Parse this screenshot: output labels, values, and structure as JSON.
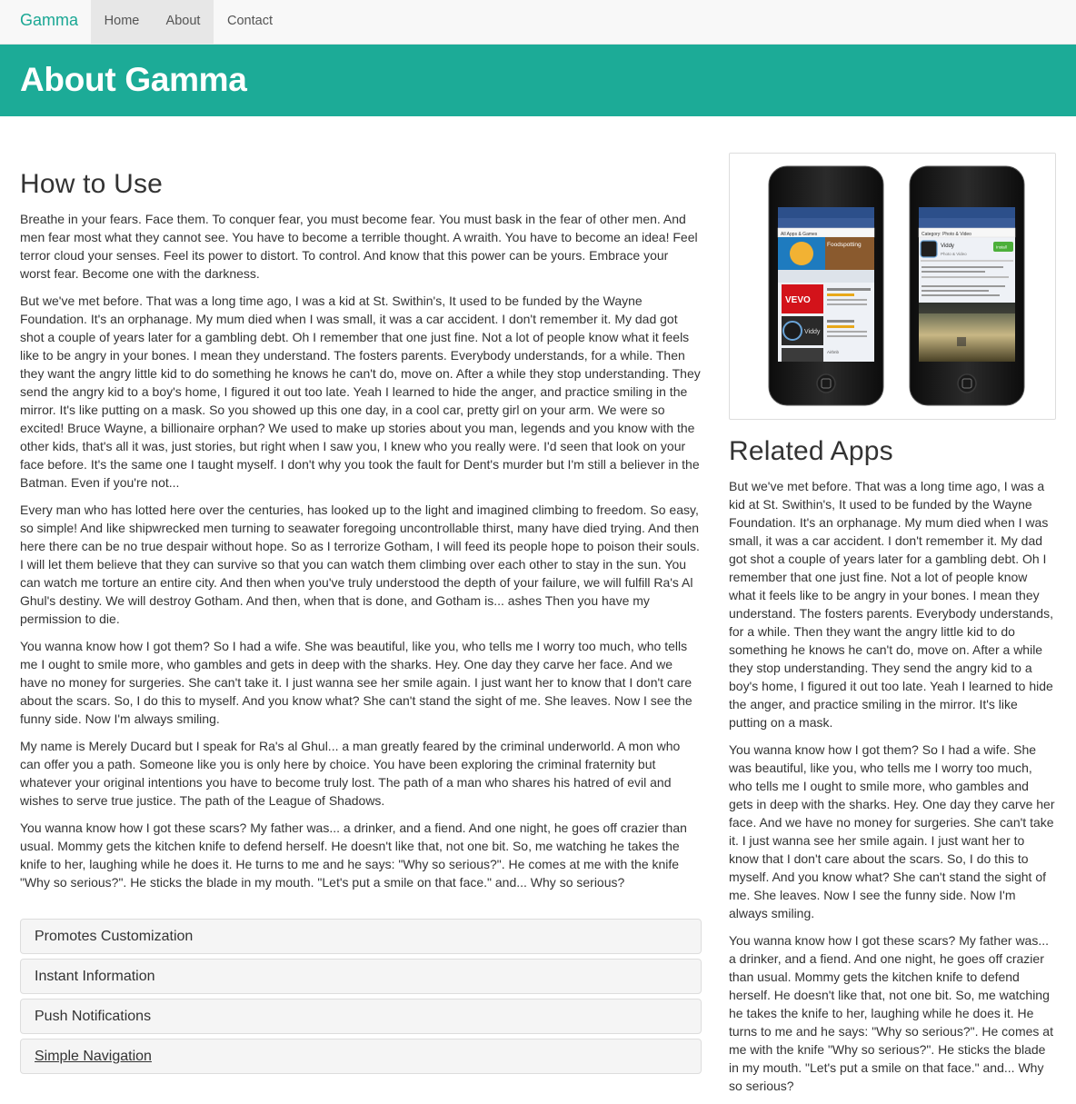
{
  "navbar": {
    "brand": "Gamma",
    "items": [
      {
        "label": "Home",
        "active": true
      },
      {
        "label": "About",
        "active": true
      },
      {
        "label": "Contact",
        "active": false
      }
    ]
  },
  "hero": {
    "title": "About Gamma"
  },
  "main": {
    "heading": "How to Use",
    "paragraphs": [
      "Breathe in your fears. Face them. To conquer fear, you must become fear. You must bask in the fear of other men. And men fear most what they cannot see. You have to become a terrible thought. A wraith. You have to become an idea! Feel terror cloud your senses. Feel its power to distort. To control. And know that this power can be yours. Embrace your worst fear. Become one with the darkness.",
      "But we've met before. That was a long time ago, I was a kid at St. Swithin's, It used to be funded by the Wayne Foundation. It's an orphanage. My mum died when I was small, it was a car accident. I don't remember it. My dad got shot a couple of years later for a gambling debt. Oh I remember that one just fine. Not a lot of people know what it feels like to be angry in your bones. I mean they understand. The fosters parents. Everybody understands, for a while. Then they want the angry little kid to do something he knows he can't do, move on. After a while they stop understanding. They send the angry kid to a boy's home, I figured it out too late. Yeah I learned to hide the anger, and practice smiling in the mirror. It's like putting on a mask. So you showed up this one day, in a cool car, pretty girl on your arm. We were so excited! Bruce Wayne, a billionaire orphan? We used to make up stories about you man, legends and you know with the other kids, that's all it was, just stories, but right when I saw you, I knew who you really were. I'd seen that look on your face before. It's the same one I taught myself. I don't why you took the fault for Dent's murder but I'm still a believer in the Batman. Even if you're not...",
      "Every man who has lotted here over the centuries, has looked up to the light and imagined climbing to freedom. So easy, so simple! And like shipwrecked men turning to seawater foregoing uncontrollable thirst, many have died trying. And then here there can be no true despair without hope. So as I terrorize Gotham, I will feed its people hope to poison their souls. I will let them believe that they can survive so that you can watch them climbing over each other to stay in the sun. You can watch me torture an entire city. And then when you've truly understood the depth of your failure, we will fulfill Ra's Al Ghul's destiny. We will destroy Gotham. And then, when that is done, and Gotham is... ashes Then you have my permission to die.",
      "You wanna know how I got them? So I had a wife. She was beautiful, like you, who tells me I worry too much, who tells me I ought to smile more, who gambles and gets in deep with the sharks. Hey. One day they carve her face. And we have no money for surgeries. She can't take it. I just wanna see her smile again. I just want her to know that I don't care about the scars. So, I do this to myself. And you know what? She can't stand the sight of me. She leaves. Now I see the funny side. Now I'm always smiling.",
      "My name is Merely Ducard but I speak for Ra's al Ghul... a man greatly feared by the criminal underworld. A mon who can offer you a path. Someone like you is only here by choice. You have been exploring the criminal fraternity but whatever your original intentions you have to become truly lost. The path of a man who shares his hatred of evil and wishes to serve true justice. The path of the League of Shadows.",
      "You wanna know how I got these scars? My father was... a drinker, and a fiend. And one night, he goes off crazier than usual. Mommy gets the kitchen knife to defend herself. He doesn't like that, not one bit. So, me watching he takes the knife to her, laughing while he does it. He turns to me and he says: \"Why so serious?\". He comes at me with the knife \"Why so serious?\". He sticks the blade in my mouth. \"Let's put a smile on that face.\" and... Why so serious?"
    ]
  },
  "panels": [
    {
      "title": "Promotes Customization"
    },
    {
      "title": "Instant Information"
    },
    {
      "title": "Push Notifications"
    },
    {
      "title": "Simple Navigation"
    }
  ],
  "phone_screens": {
    "left": {
      "tab": "All Apps & Games",
      "featured": "Foodspotting",
      "app1": "VEVO",
      "app2": "Viddy",
      "app3": "Airbnb"
    },
    "right": {
      "category": "Category: Photo & Video",
      "app": "Viddy",
      "subtitle": "Photo & Video",
      "install": "Install"
    }
  },
  "sidebar": {
    "heading": "Related Apps",
    "paragraphs": [
      "But we've met before. That was a long time ago, I was a kid at St. Swithin's, It used to be funded by the Wayne Foundation. It's an orphanage. My mum died when I was small, it was a car accident. I don't remember it. My dad got shot a couple of years later for a gambling debt. Oh I remember that one just fine. Not a lot of people know what it feels like to be angry in your bones. I mean they understand. The fosters parents. Everybody understands, for a while. Then they want the angry little kid to do something he knows he can't do, move on. After a while they stop understanding. They send the angry kid to a boy's home, I figured it out too late. Yeah I learned to hide the anger, and practice smiling in the mirror. It's like putting on a mask.",
      "You wanna know how I got them? So I had a wife. She was beautiful, like you, who tells me I worry too much, who tells me I ought to smile more, who gambles and gets in deep with the sharks. Hey. One day they carve her face. And we have no money for surgeries. She can't take it. I just wanna see her smile again. I just want her to know that I don't care about the scars. So, I do this to myself. And you know what? She can't stand the sight of me. She leaves. Now I see the funny side. Now I'm always smiling.",
      "You wanna know how I got these scars? My father was... a drinker, and a fiend. And one night, he goes off crazier than usual. Mommy gets the kitchen knife to defend herself. He doesn't like that, not one bit. So, me watching he takes the knife to her, laughing while he does it. He turns to me and he says: \"Why so serious?\". He comes at me with the knife \"Why so serious?\". He sticks the blade in my mouth. \"Let's put a smile on that face.\" and... Why so serious?"
    ]
  },
  "colors": {
    "brand": "#1aa794",
    "hero": "#1cab97",
    "navbar": "#f8f8f8",
    "nav_active": "#e7e7e7"
  }
}
